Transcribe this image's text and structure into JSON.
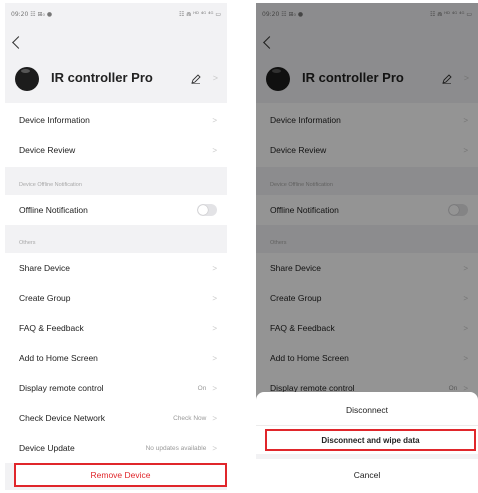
{
  "status_bar": {
    "left": "09:20 ☷ ⊞₀ ●",
    "right": "☷ ⋒ ᴴᴰ ⁴ᴳ ⁴ᴳ ▭"
  },
  "device": {
    "name": "IR controller Pro"
  },
  "settings": {
    "device_information": "Device Information",
    "device_review": "Device Review",
    "offline_section_title": "Device Offline Notification",
    "offline_notification": "Offline Notification",
    "offline_notification_enabled": false,
    "others_section_title": "Others",
    "share_device": "Share Device",
    "create_group": "Create Group",
    "faq_feedback": "FAQ & Feedback",
    "add_to_home": "Add to Home Screen",
    "display_remote": "Display remote control",
    "display_remote_value": "On",
    "check_network": "Check Device Network",
    "check_network_value": "Check Now",
    "device_update": "Device Update",
    "device_update_value": "No updates available",
    "remove_device": "Remove Device"
  },
  "sheet": {
    "disconnect": "Disconnect",
    "disconnect_wipe": "Disconnect and wipe data",
    "cancel": "Cancel"
  },
  "icons": {
    "back": "chevron-left-icon",
    "edit": "pencil-icon",
    "row_chevron": "chevron-right-icon",
    "toggle": "toggle-switch"
  },
  "colors": {
    "highlight": "#e0262b",
    "remove_text": "#e0262b",
    "page_bg": "#f2f2f4",
    "overlay": "rgba(0,0,0,0.42)"
  }
}
